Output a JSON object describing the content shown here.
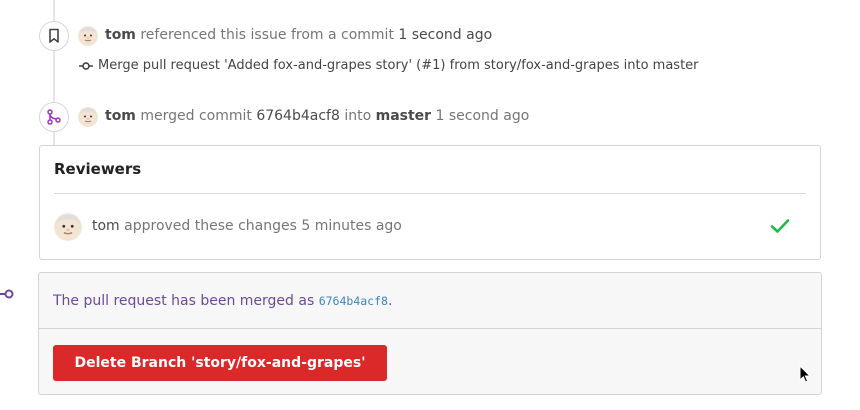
{
  "events": [
    {
      "user": "tom",
      "action": "referenced this issue from a commit",
      "time": "1 second ago",
      "commit_message": "Merge pull request 'Added fox-and-grapes story' (#1) from story/fox-and-grapes into master"
    },
    {
      "user": "tom",
      "action_pre": "merged commit",
      "commit": "6764b4acf8",
      "action_mid": "into",
      "branch": "master",
      "time": "1 second ago"
    }
  ],
  "reviewers": {
    "title": "Reviewers",
    "items": [
      {
        "user": "tom",
        "text": "approved these changes 5 minutes ago"
      }
    ]
  },
  "merged": {
    "message_prefix": "The pull request has been merged as",
    "commit": "6764b4acf8",
    "message_suffix": ".",
    "delete_button": "Delete Branch 'story/fox-and-grapes'"
  },
  "colors": {
    "merge_purple": "#a333c8",
    "danger": "#db2828",
    "approved_green": "#21ba45",
    "link_blue": "#4183c4"
  }
}
